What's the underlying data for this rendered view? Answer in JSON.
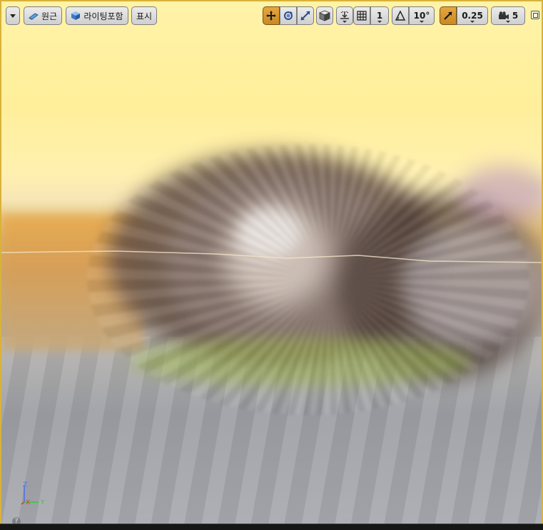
{
  "toolbar": {
    "perspective_label": "원근",
    "lighting_label": "라이팅포함",
    "show_label": "표시",
    "grid_snap_value": "1",
    "rotation_snap_value": "10°",
    "scale_snap_value": "0.25",
    "camera_speed_value": "5"
  },
  "axis_gizmo": {
    "z": "Z",
    "x": "X",
    "y": "Y"
  },
  "help_glyph": "?",
  "colors": {
    "accent": "#d9a036",
    "axis_x": "#d83a3a",
    "axis_y": "#3ec43e",
    "axis_z": "#4a6ee8"
  }
}
